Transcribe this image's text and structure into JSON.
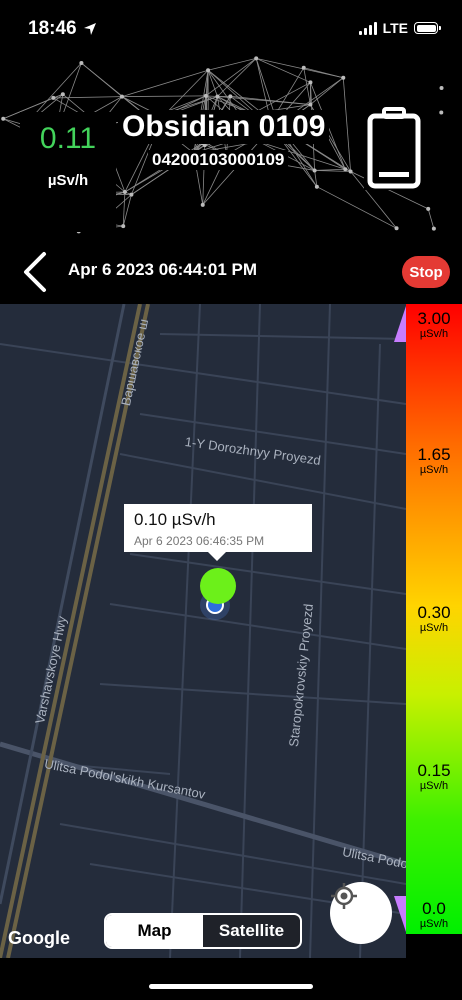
{
  "status_bar": {
    "time": "18:46",
    "network": "LTE"
  },
  "header": {
    "reading_value": "0.11",
    "reading_unit": "µSv/h",
    "device_name": "Obsidian 0109",
    "device_serial": "04200103000109"
  },
  "nav": {
    "session_date": "Apr 6 2023 06:44:01 PM",
    "stop_label": "Stop"
  },
  "map": {
    "labels": {
      "varshavskoe": "Варшавское ш",
      "dorozhnyy": "1-Y Dorozhnyy Proyezd",
      "varshavskoye_hwy": "Varshavskoye Hwy",
      "staropokrovskiy": "Staropokrovskiy Proyezd",
      "podolskikh": "Ulitsa Podol'skikh Kursantov",
      "podolskikh_short": "Ulitsa Podo"
    },
    "callout": {
      "value": "0.10 µSv/h",
      "time": "Apr 6 2023 06:46:35 PM"
    },
    "marker_color": "#6cf01a",
    "google_logo": "Google",
    "toggle": {
      "map": "Map",
      "satellite": "Satellite",
      "active": "Map"
    }
  },
  "legend": [
    {
      "value": "3.00",
      "unit": "µSv/h"
    },
    {
      "value": "1.65",
      "unit": "µSv/h"
    },
    {
      "value": "0.30",
      "unit": "µSv/h"
    },
    {
      "value": "0.15",
      "unit": "µSv/h"
    },
    {
      "value": "0.0",
      "unit": "µSv/h"
    }
  ],
  "colors": {
    "reading_green": "#43d35b",
    "stop_red": "#e43a34",
    "map_bg": "#242c3b"
  }
}
